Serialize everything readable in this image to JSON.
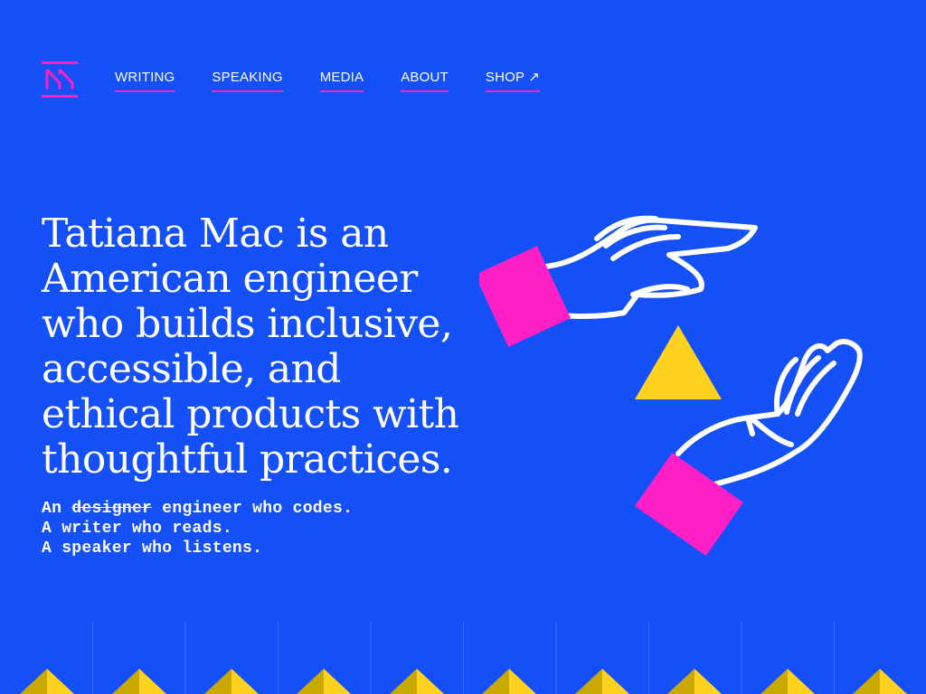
{
  "nav": {
    "logo_icon": "tm-monogram-logo",
    "items": [
      {
        "label": "WRITING"
      },
      {
        "label": "SPEAKING"
      },
      {
        "label": "MEDIA"
      },
      {
        "label": "ABOUT"
      },
      {
        "label": "SHOP",
        "icon": "external-arrow-icon",
        "arrow": "↗"
      }
    ]
  },
  "hero": {
    "headline": "Tatiana Mac is an American engineer who builds inclusive, accessible, and ethical products with thoughtful practices.",
    "tagline": {
      "line1_prefix": "An",
      "line1_struck": "designer",
      "line1_suffix": "engineer who codes.",
      "line2": "A writer who reads.",
      "line3": "A speaker who listens."
    },
    "illustration_icon": "hands-passing-triangle-illustration"
  },
  "colors": {
    "background": "#1450f5",
    "accent_pink": "#ff1fc7",
    "accent_yellow": "#ffd21f",
    "text": "#ffffff"
  }
}
